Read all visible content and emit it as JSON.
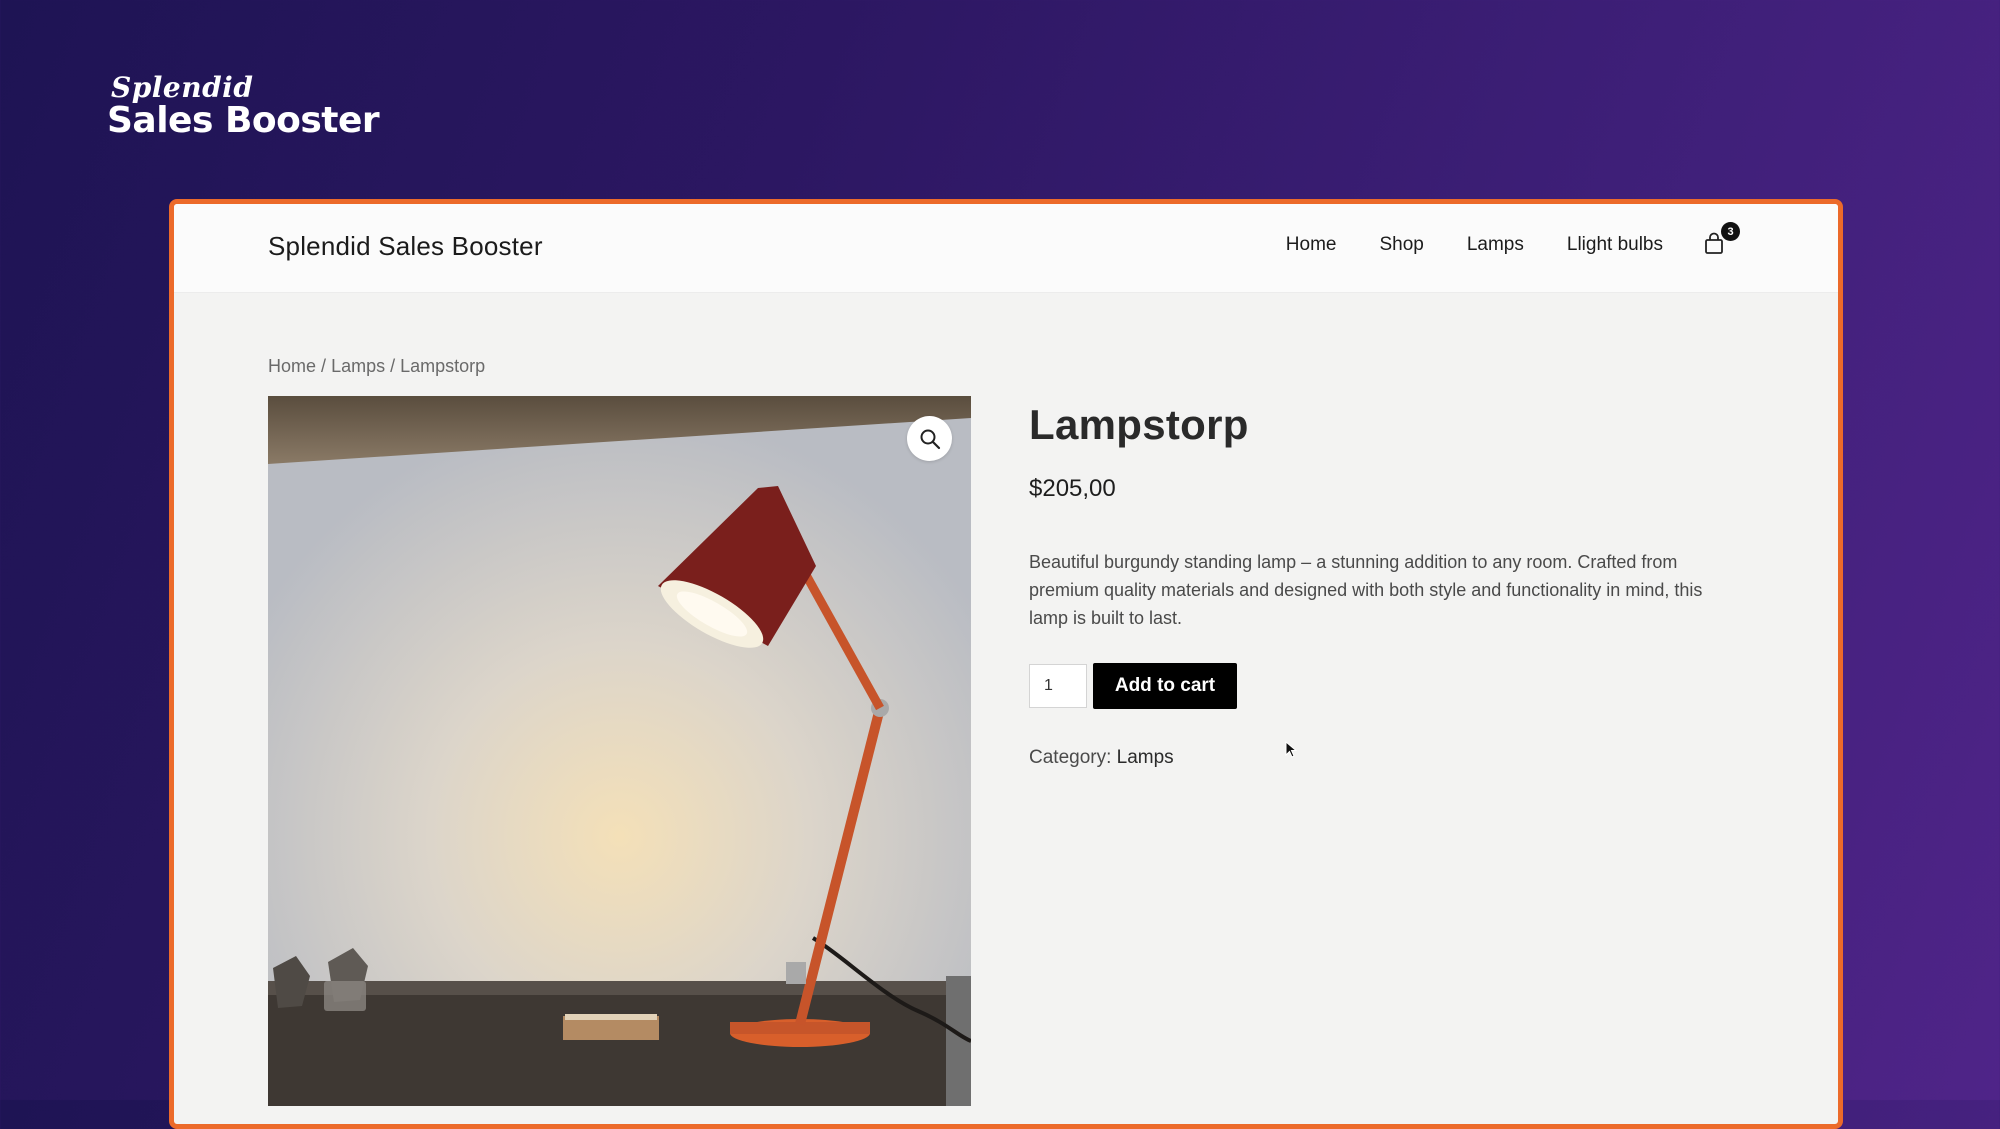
{
  "promo": {
    "brand_script": "Splendid",
    "brand_main": "Sales Booster"
  },
  "header": {
    "site_title": "Splendid Sales Booster",
    "nav": [
      "Home",
      "Shop",
      "Lamps",
      "Llight bulbs"
    ],
    "cart_count": "3"
  },
  "breadcrumb": {
    "items": [
      "Home",
      "Lamps",
      "Lampstorp"
    ],
    "separator": "/"
  },
  "product": {
    "title": "Lampstorp",
    "price": "$205,00",
    "description": "Beautiful burgundy standing lamp – a stunning addition to any room. Crafted from premium quality materials and designed with both style and functionality in mind, this lamp is built to last.",
    "quantity": "1",
    "add_to_cart_label": "Add to cart",
    "category_label": "Category:",
    "category_value": "Lamps"
  },
  "icons": {
    "cart": "shopping-bag-icon",
    "zoom": "magnifier-icon"
  },
  "colors": {
    "frame_border": "#ec6a2a",
    "button_bg": "#000000",
    "background_start": "#1e1454",
    "background_end": "#4f2488"
  }
}
